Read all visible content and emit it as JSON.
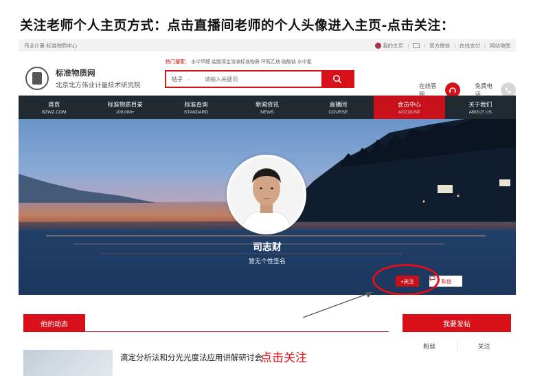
{
  "headline": "关注老师个人主页方式：点击直播间老师的个人头像进入主页-点击关注：",
  "topbar": {
    "left": "伟业计量-标准物质中心",
    "my_home": "我的主页",
    "wechat": "官方微信",
    "pay": "在线支付",
    "sitemap": "网站地图"
  },
  "logo": {
    "title": "标准物质网",
    "subtitle": "北京北方伟业计量技术研究院"
  },
  "hot": {
    "label": "热门搜索：",
    "terms": "水中甲醛  盐酸滴定溶液标准物质  环氧乙烷  硫酸钠  水中氰"
  },
  "search": {
    "category": "帖子",
    "placeholder": "请输入关键词"
  },
  "service": {
    "online": "在线客服",
    "phone": "免费电话"
  },
  "nav": [
    {
      "cn": "首页",
      "en": "BZWZ.COM"
    },
    {
      "cn": "标准物质目录",
      "en": "100,000+"
    },
    {
      "cn": "标准查询",
      "en": "STANDARD"
    },
    {
      "cn": "新闻资讯",
      "en": "NEWS"
    },
    {
      "cn": "直播间",
      "en": "COURSE"
    },
    {
      "cn": "会员中心",
      "en": "ACCOUNT"
    },
    {
      "cn": "关于我们",
      "en": "ABOUT US"
    }
  ],
  "profile": {
    "name": "司志财",
    "signature": "暂无个性签名",
    "follow": "+关注",
    "message": "私信"
  },
  "section": {
    "activity": "他的动态",
    "post": "我要发帖",
    "fans": "粉丝",
    "following": "关注"
  },
  "post": {
    "title": "滴定分析法和分光光度法应用讲解研讨会"
  },
  "annotation": "点击关注",
  "colors": {
    "brand_red": "#d8101a",
    "nav_bg": "#1f2a33"
  }
}
